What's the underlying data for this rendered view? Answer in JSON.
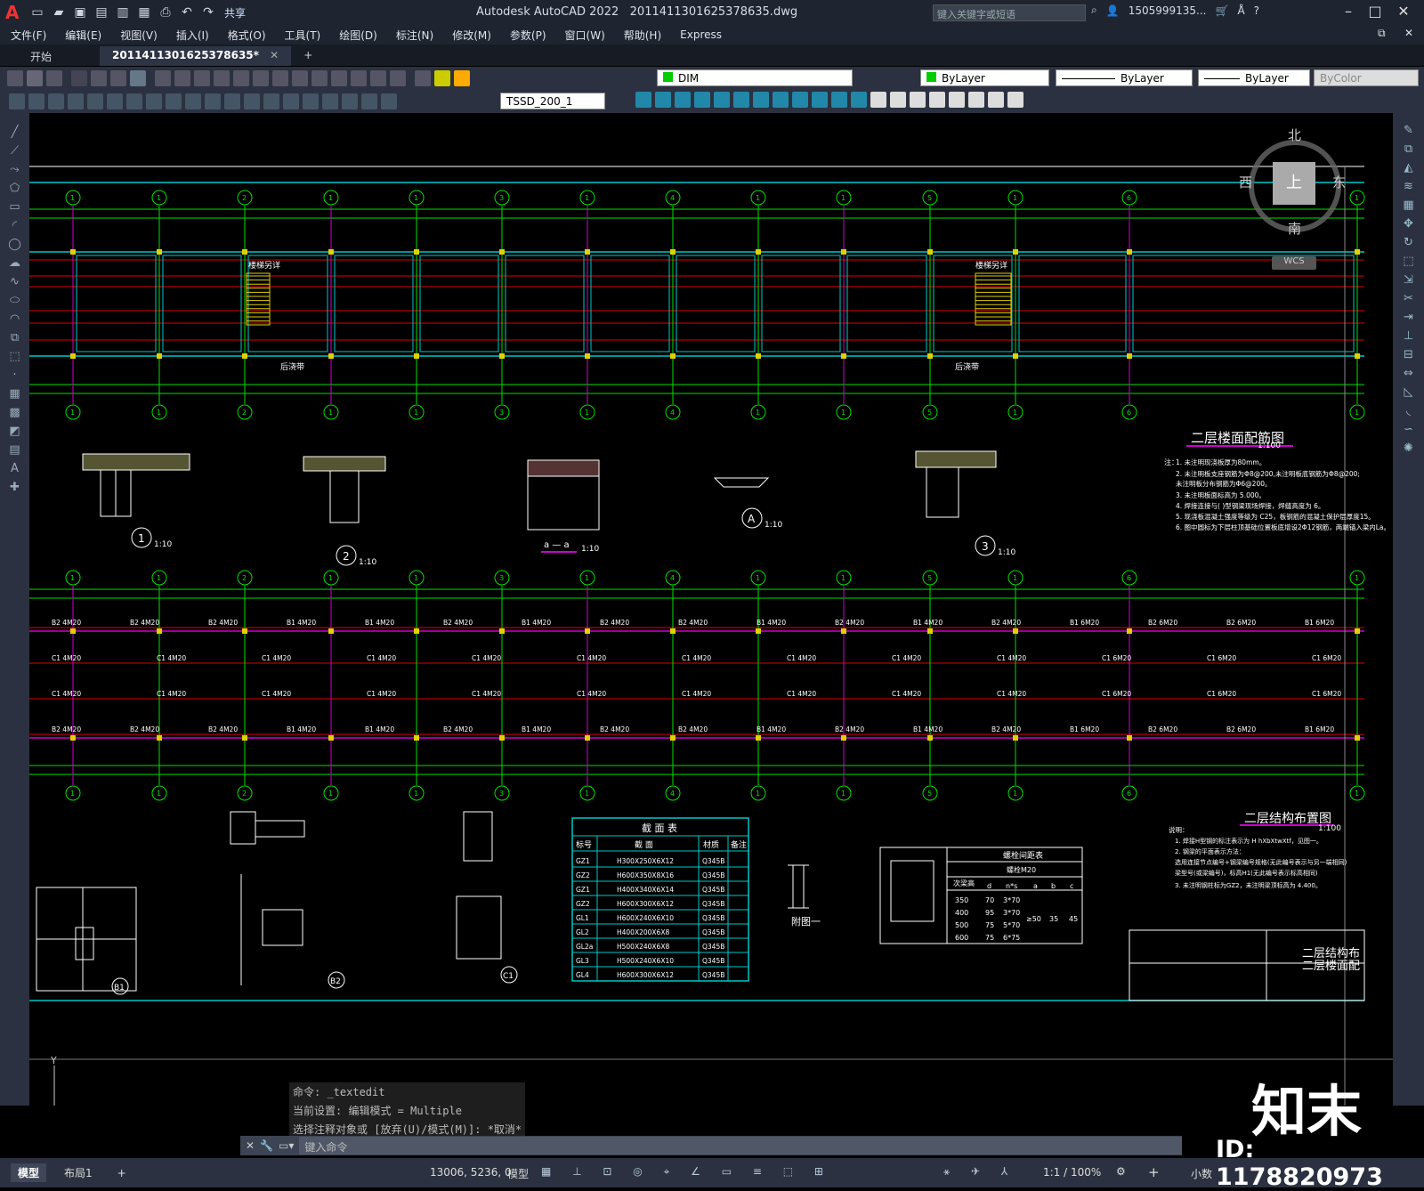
{
  "app": {
    "title": "Autodesk AutoCAD 2022",
    "file": "2011411301625378635.dwg",
    "share": "共享",
    "search_placeholder": "键入关键字或短语",
    "user": "1505999135...",
    "logo": "A"
  },
  "menu": [
    "文件(F)",
    "编辑(E)",
    "视图(V)",
    "插入(I)",
    "格式(O)",
    "工具(T)",
    "绘图(D)",
    "标注(N)",
    "修改(M)",
    "参数(P)",
    "窗口(W)",
    "帮助(H)",
    "Express"
  ],
  "tabs": {
    "start": "开始",
    "doc": "2011411301625378635*",
    "add": "+"
  },
  "toolbar": {
    "layer": "DIM",
    "color": "ByLayer",
    "linetype": "ByLayer",
    "lineweight": "ByLayer",
    "plotstyle": "ByColor",
    "dimstyle": "TSSD_200_1"
  },
  "viewcube": {
    "north": "北",
    "south": "南",
    "west": "西",
    "east": "东",
    "top": "上",
    "wcs": "WCS"
  },
  "drawing": {
    "axis_top": [
      "1",
      "1",
      "2",
      "1",
      "1",
      "3",
      "1",
      "4",
      "1",
      "1",
      "5",
      "1",
      "6"
    ],
    "axis_mid": [
      "1",
      "1",
      "2",
      "1",
      "1",
      "3",
      "1",
      "4",
      "1",
      "1",
      "5",
      "1",
      "6"
    ],
    "stair_label": "楼梯另详",
    "stair_label2": "楼梯另详",
    "post_label": "后浇带",
    "floor_title": "二层楼面配筋图",
    "floor_scale": "1:100",
    "struct_title": "二层结构布置图",
    "struct_scale": "1:100",
    "detail1_scale": "1:10",
    "detail2_scale": "1:10",
    "detailA_scale": "1:10",
    "detail3_scale": "1:10",
    "sectiona_scale": "1:10",
    "section_a_label": "a — a",
    "notes_title": "注：",
    "notes": [
      "1. 未注明现浇板厚为80mm。",
      "2. 未注明板支座钢筋为Φ8@200,未注明板底钢筋为Φ8@200;",
      "   未注明板分布钢筋为Φ6@200。",
      "3. 未注明板面标高为 5.000。",
      "4. 焊接连接与( )型钢梁现场焊接，焊缝高度为 6。",
      "5. 现浇板混凝土强度等级为 C25，板钢筋的混凝土保护层厚度15。",
      "6. 图中圆标为下层柱顶基础位置板底增设2Φ12钢筋，两端锚入梁内La。"
    ],
    "struct_notes_title": "说明：",
    "struct_notes": [
      "1. 焊接H型钢的标注表示为 H hXbXtwXtf，见图一。",
      "2. 钢梁的平面表示方法：",
      "   选用连接节点编号+钢梁编号规格(无此编号表示与另一端相同)",
      "   梁型号(或梁编号)，标高H1(无此编号表示标高相同)",
      "3. 未注明钢柱标为GZ2，未注明梁顶标高为 4.400。"
    ],
    "beam_labels_row1": [
      "B2 4M20",
      "B2 4M20",
      "B2 4M20",
      "B1 4M20",
      "B1 4M20",
      "B2 4M20",
      "B1 4M20",
      "B2 4M20",
      "B2 4M20",
      "B1 4M20",
      "B2 4M20",
      "B1 4M20",
      "B2 4M20",
      "B1 6M20",
      "B2 6M20",
      "B2 6M20",
      "B1 6M20"
    ],
    "beam_labels_row2": [
      "C1 4M20",
      "C1 4M20",
      "C1 4M20",
      "C1 4M20",
      "C1 4M20",
      "C1 4M20",
      "C1 4M20",
      "C1 4M20",
      "C1 4M20",
      "C1 4M20",
      "C1 6M20",
      "C1 6M20",
      "C1 6M20"
    ],
    "section_table": {
      "title": "截 面 表",
      "headers": [
        "标号",
        "截 面",
        "材质",
        "备注"
      ],
      "rows": [
        [
          "GZ1",
          "H300X250X6X12",
          "Q345B",
          ""
        ],
        [
          "GZ2",
          "H600X350X8X16",
          "Q345B",
          ""
        ],
        [
          "GZ1",
          "H400X340X6X14",
          "Q345B",
          ""
        ],
        [
          "GZ2",
          "H600X300X6X12",
          "Q345B",
          ""
        ],
        [
          "GL1",
          "H600X240X6X10",
          "Q345B",
          ""
        ],
        [
          "GL2",
          "H400X200X6X8",
          "Q345B",
          ""
        ],
        [
          "GL2a",
          "H500X240X6X8",
          "Q345B",
          ""
        ],
        [
          "GL3",
          "H500X240X6X10",
          "Q345B",
          ""
        ],
        [
          "GL4",
          "H600X300X6X12",
          "Q345B",
          ""
        ]
      ]
    },
    "bolt_table": {
      "title": "螺栓间距表",
      "sub": "螺栓M20",
      "col_h": "次梁高",
      "headers": [
        "d",
        "n*s",
        "a",
        "b",
        "c"
      ],
      "rows": [
        [
          "350",
          "70",
          "3*70"
        ],
        [
          "400",
          "95",
          "3*70"
        ],
        [
          "500",
          "75",
          "5*70"
        ],
        [
          "600",
          "75",
          "6*75"
        ]
      ],
      "a": "≥50",
      "b": "35",
      "c": "45"
    },
    "fig_label": "附图一",
    "detail_B1": "B1",
    "detail_B2": "B2",
    "detail_C1": "C1",
    "title_block": {
      "title1": "二层结构布",
      "title2": "二层楼面配"
    }
  },
  "command": {
    "history": [
      "命令: _textedit",
      "当前设置: 编辑模式 = Multiple",
      "选择注释对象或 [放弃(U)/模式(M)]: *取消*"
    ],
    "placeholder": "键入命令"
  },
  "status": {
    "model_tab": "模型",
    "layout_tab": "布局1",
    "add": "+",
    "coords": "13006, 5236, 0",
    "model": "模型",
    "scale": "1:1 / 100%",
    "units": "小数"
  },
  "watermark": {
    "brand": "知末",
    "id": "ID: 1178820973"
  },
  "colors": {
    "grid_green": "#00e000",
    "cyan": "#00c8c8",
    "red": "#e00000",
    "magenta": "#d000d0",
    "yellow": "#e0d000",
    "white": "#ffffff",
    "ui_dark": "#2b3140"
  }
}
